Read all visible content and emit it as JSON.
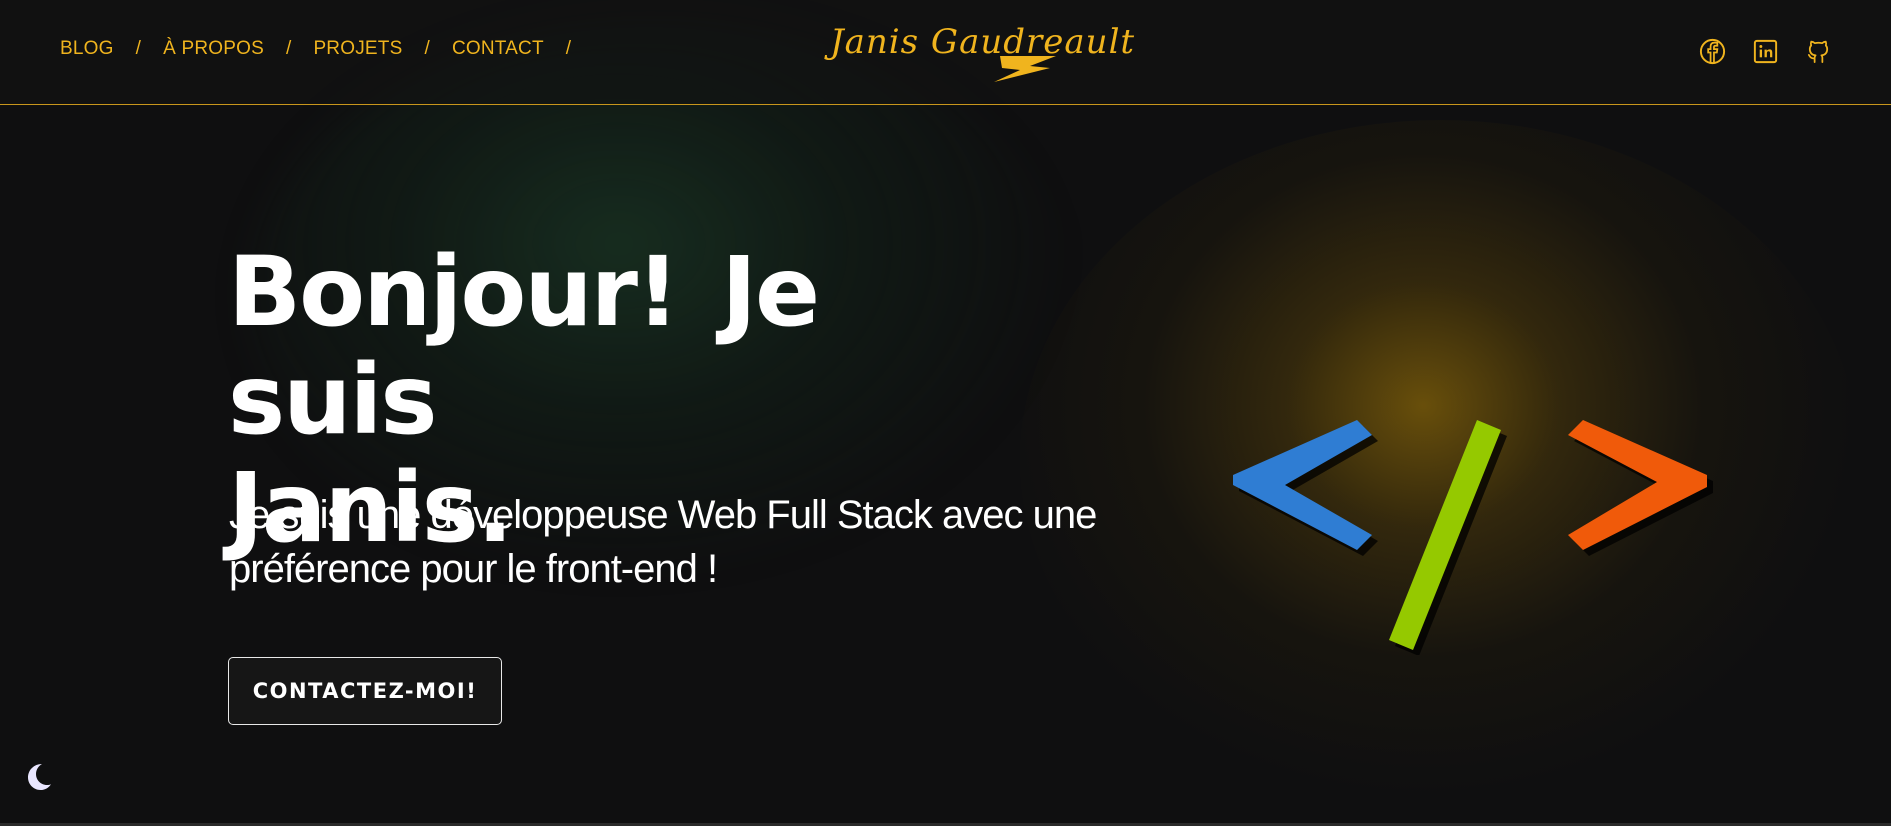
{
  "nav": {
    "items": [
      {
        "label": "BLOG"
      },
      {
        "label": "À PROPOS"
      },
      {
        "label": "PROJETS"
      },
      {
        "label": "CONTACT"
      }
    ],
    "separator": "/"
  },
  "logo": {
    "text": "Janis Gaudreault",
    "icon": "lightning-bolt-icon"
  },
  "socials": [
    {
      "name": "facebook",
      "icon": "facebook-icon"
    },
    {
      "name": "linkedin",
      "icon": "linkedin-icon"
    },
    {
      "name": "github",
      "icon": "github-icon"
    }
  ],
  "hero": {
    "title_line1": "Bonjour! Je suis",
    "title_line2": "Janis.",
    "subtitle_line1": "Je suis une développeuse Web Full Stack avec une",
    "subtitle_line2": "préférence pour le front-end !",
    "cta_label": "CONTACTEZ-MOI!"
  },
  "illustration": {
    "icon": "code-brackets-icon",
    "left_bracket_color": "#2f7dd3",
    "slash_color": "#95c900",
    "right_bracket_color": "#f05a0a"
  },
  "theme_toggle": {
    "icon": "moon-icon"
  },
  "colors": {
    "accent": "#f0b41e",
    "background": "#0f0f10",
    "text": "#ffffff"
  }
}
